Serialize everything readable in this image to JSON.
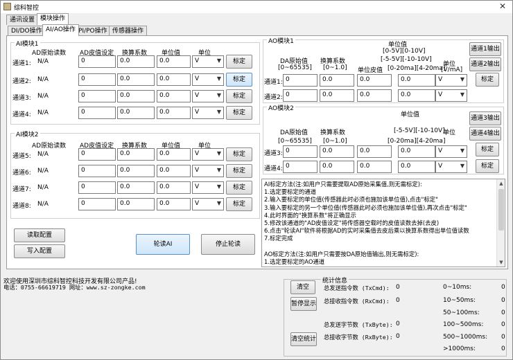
{
  "window": {
    "title": "综科智控",
    "close": "✕"
  },
  "top_tabs": [
    "通讯设置",
    "模块操作"
  ],
  "sub_tabs": [
    "DI/DO操作",
    "AI/AO操作",
    "PI/PO操作",
    "传感器操作"
  ],
  "ai_headers": {
    "ad_raw": "AD原始读数",
    "ad_zero": "AD皮值设定",
    "factor": "换算系数",
    "unit_val": "单位值",
    "unit": "单位",
    "calib": "标定"
  },
  "ai_module1": {
    "title": "AI模块1",
    "rows": [
      {
        "label": "通道1:",
        "raw": "N/A",
        "zero": "0",
        "factor": "0.0",
        "unit_val": "0.0",
        "unit": "V"
      },
      {
        "label": "通道2:",
        "raw": "N/A",
        "zero": "0",
        "factor": "0.0",
        "unit_val": "0.0",
        "unit": "V"
      },
      {
        "label": "通道3:",
        "raw": "N/A",
        "zero": "0",
        "factor": "0.0",
        "unit_val": "0.0",
        "unit": "V"
      },
      {
        "label": "通道4:",
        "raw": "N/A",
        "zero": "0",
        "factor": "0.0",
        "unit_val": "0.0",
        "unit": "V"
      }
    ]
  },
  "ai_module2": {
    "title": "AI模块2",
    "rows": [
      {
        "label": "通道5:",
        "raw": "N/A",
        "zero": "0",
        "factor": "0.0",
        "unit_val": "0.0",
        "unit": "V"
      },
      {
        "label": "通道6:",
        "raw": "N/A",
        "zero": "0",
        "factor": "0.0",
        "unit_val": "0.0",
        "unit": "V"
      },
      {
        "label": "通道7:",
        "raw": "N/A",
        "zero": "0",
        "factor": "0.0",
        "unit_val": "0.0",
        "unit": "V"
      },
      {
        "label": "通道8:",
        "raw": "N/A",
        "zero": "0",
        "factor": "0.0",
        "unit_val": "0.0",
        "unit": "V"
      }
    ]
  },
  "ao_headers": {
    "da_raw": "DA原始值",
    "da_range": "[0~65535]",
    "factor": "换算系数",
    "factor_range": "[0~1.0]",
    "unit_zero": "单位皮值",
    "unit_val": "单位值",
    "range1": "[0-5V][0-10V]",
    "range2": "[-5-5V][-10-10V]",
    "range3": "[0-20ma][4-20ma]",
    "unit": "单位",
    "unit_sub": "[V/mA]"
  },
  "ao_module1": {
    "title": "AO模块1",
    "out_buttons": [
      "通道1输出",
      "通道2输出"
    ],
    "calib": "标定",
    "rows": [
      {
        "label": "通道1:",
        "da": "0",
        "factor": "0.0",
        "zero": "0.0",
        "val": "0.0",
        "unit": "V"
      },
      {
        "label": "通道2:",
        "da": "0",
        "factor": "0.0",
        "zero": "0.0",
        "val": "0.0",
        "unit": "V"
      }
    ]
  },
  "ao_module2": {
    "title": "AO模块2",
    "out_buttons": [
      "通道3输出",
      "通道4输出"
    ],
    "calib": "标定",
    "rows": [
      {
        "label": "通道3:",
        "da": "0",
        "factor": "0.0",
        "zero": "0.0",
        "val": "0.0",
        "unit": "V"
      },
      {
        "label": "通道4:",
        "da": "0",
        "factor": "0.0",
        "zero": "0.0",
        "val": "0.0",
        "unit": "V"
      }
    ]
  },
  "help_lines": [
    "AI标定方法(注:如用户只需要提取AD原始采集值,则无需标定):",
    "1.选定要标定的通道",
    "2.输入要标定的单位值(传感器此时必须也施加该单位值),点击\"标定\"",
    "3.输入要标定的另一个单位值(传感器此时必须也施加该单位值),再次点击\"标定\"",
    "4.此时界面的\"换算系数\"将正确显示",
    "5.修改该通道的\"AD皮值设定\"将传感器空载时的皮值读数去掉(去皮)",
    "6.点击\"轮读AI\"软件将根据AD的实时采集值去皮后乘以换算系数得出单位值读数",
    "7.标定完成",
    "",
    "AO标定方法(注:如用户只需要按DA原始值输出,则无需标定):",
    "1.选定要标定的AO通道"
  ],
  "buttons": {
    "read_config": "读取配置",
    "write_config": "写入配置",
    "poll_ai": "轮读AI",
    "stop_poll": "停止轮读"
  },
  "footer": {
    "line1": "欢迎使用深圳市综科智控科技开发有限公司产品!",
    "line2": "电话：0755-66619719 网址：www.sz-zongke.com"
  },
  "stats": {
    "title": "统计信息",
    "clear": "清空",
    "pause": "暂停显示",
    "clear_stats": "清空统计",
    "tx_cmd": "总发送指令数 (TxCmd):",
    "tx_cmd_val": "0",
    "rx_cmd": "总接收指令数 (RxCmd):",
    "rx_cmd_val": "0",
    "tx_byte": "总发送字节数 (TxByte):",
    "tx_byte_val": "0",
    "rx_byte": "总接收字节数 (RxByte):",
    "rx_byte_val": "0",
    "bins": [
      "0~10ms:",
      "10~50ms:",
      "50~100ms:",
      "100~500ms:",
      "500~1000ms:",
      ">1000ms:"
    ],
    "bin_vals": [
      "0",
      "0",
      "0",
      "0",
      "0",
      "0"
    ]
  }
}
